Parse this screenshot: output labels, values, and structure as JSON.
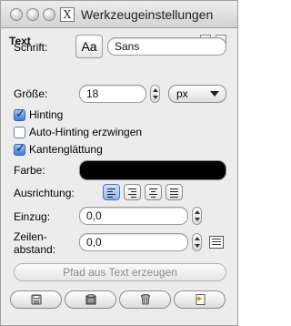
{
  "window": {
    "title": "Werkzeugeinstellungen",
    "app_icon_glyph": "X",
    "controls": [
      "close-icon",
      "minimize-icon",
      "zoom-icon"
    ]
  },
  "dock": {
    "title": "Text",
    "buttons": [
      "tab-menu-icon",
      "configure-icon"
    ]
  },
  "text_options": {
    "font_label": "Schrift:",
    "font_preview": "Aa",
    "font_value": "Sans",
    "size_label": "Größe:",
    "size_value": "18",
    "unit_value": "px",
    "hinting_label": "Hinting",
    "hinting_checked": true,
    "autohint_label": "Auto-Hinting erzwingen",
    "autohint_checked": false,
    "antialias_label": "Kantenglättung",
    "antialias_checked": true,
    "color_label": "Farbe:",
    "color_value": "#000000",
    "justify_label": "Ausrichtung:",
    "justify_options": [
      "align-left-icon",
      "align-right-icon",
      "align-center-icon",
      "align-justify-icon"
    ],
    "justify_selected": "align-left-icon",
    "indent_label": "Einzug:",
    "indent_value": "0,0",
    "line_spacing_label_1": "Zeilen-",
    "line_spacing_label_2": "abstand:",
    "line_spacing_value": "0,0",
    "path_button_label": "Pfad aus Text erzeugen"
  },
  "footer": {
    "buttons": [
      "save-icon",
      "restore-icon",
      "delete-icon",
      "reset-icon"
    ]
  }
}
